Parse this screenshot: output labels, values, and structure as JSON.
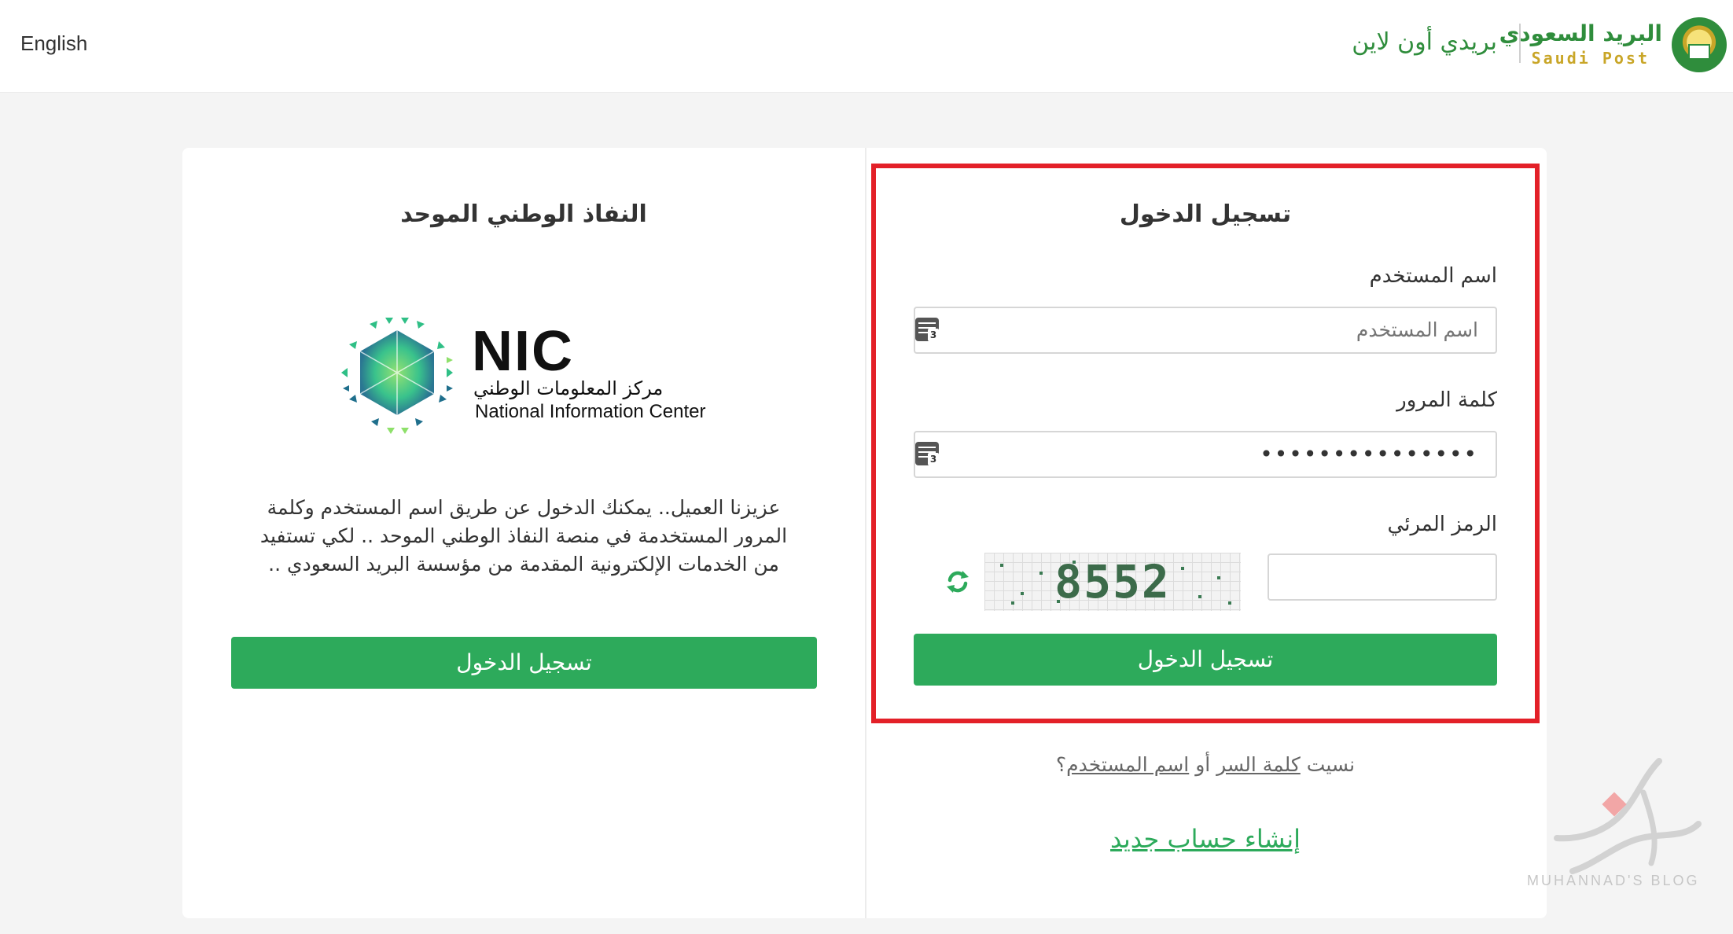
{
  "header": {
    "language_link": "English",
    "brand_name_ar": "البريد السعودي",
    "brand_name_en": "Saudi Post",
    "tagline": "بريدي أون لاين",
    "emblem_icon": "saudi-post-emblem-icon"
  },
  "nic_panel": {
    "title": "النفاذ الوطني الموحد",
    "logo_word": "NIC",
    "logo_sub_ar": "مركز المعلومات الوطني",
    "logo_sub_en": "National Information Center",
    "description": "عزيزنا العميل.. يمكنك الدخول عن طريق اسم المستخدم وكلمة المرور المستخدمة في منصة النفاذ الوطني الموحد .. لكي تستفيد من الخدمات الإلكترونية المقدمة من مؤسسة البريد السعودي ..",
    "login_button": "تسجيل الدخول"
  },
  "login_panel": {
    "title": "تسجيل الدخول",
    "username_label": "اسم المستخدم",
    "username_placeholder": "اسم المستخدم",
    "password_label": "كلمة المرور",
    "password_value": "•••••••••••••••",
    "captcha_label": "الرمز المرئي",
    "captcha_text": "8552",
    "refresh_icon": "refresh-icon",
    "keyboard_icon": "virtual-keyboard-icon",
    "login_button": "تسجيل الدخول",
    "forgot_prefix": "نسيت",
    "forgot_password_link": "كلمة السر",
    "forgot_or": "أو",
    "forgot_username_link": "اسم المستخدم",
    "forgot_suffix": "؟",
    "register_link": "إنشاء حساب جديد",
    "highlight_color": "#e32028"
  },
  "colors": {
    "brand_green": "#2f8d3c",
    "button_green": "#2daa5b",
    "brand_gold": "#c9a628"
  },
  "watermark": {
    "text": "MUHANNAD'S BLOG"
  }
}
